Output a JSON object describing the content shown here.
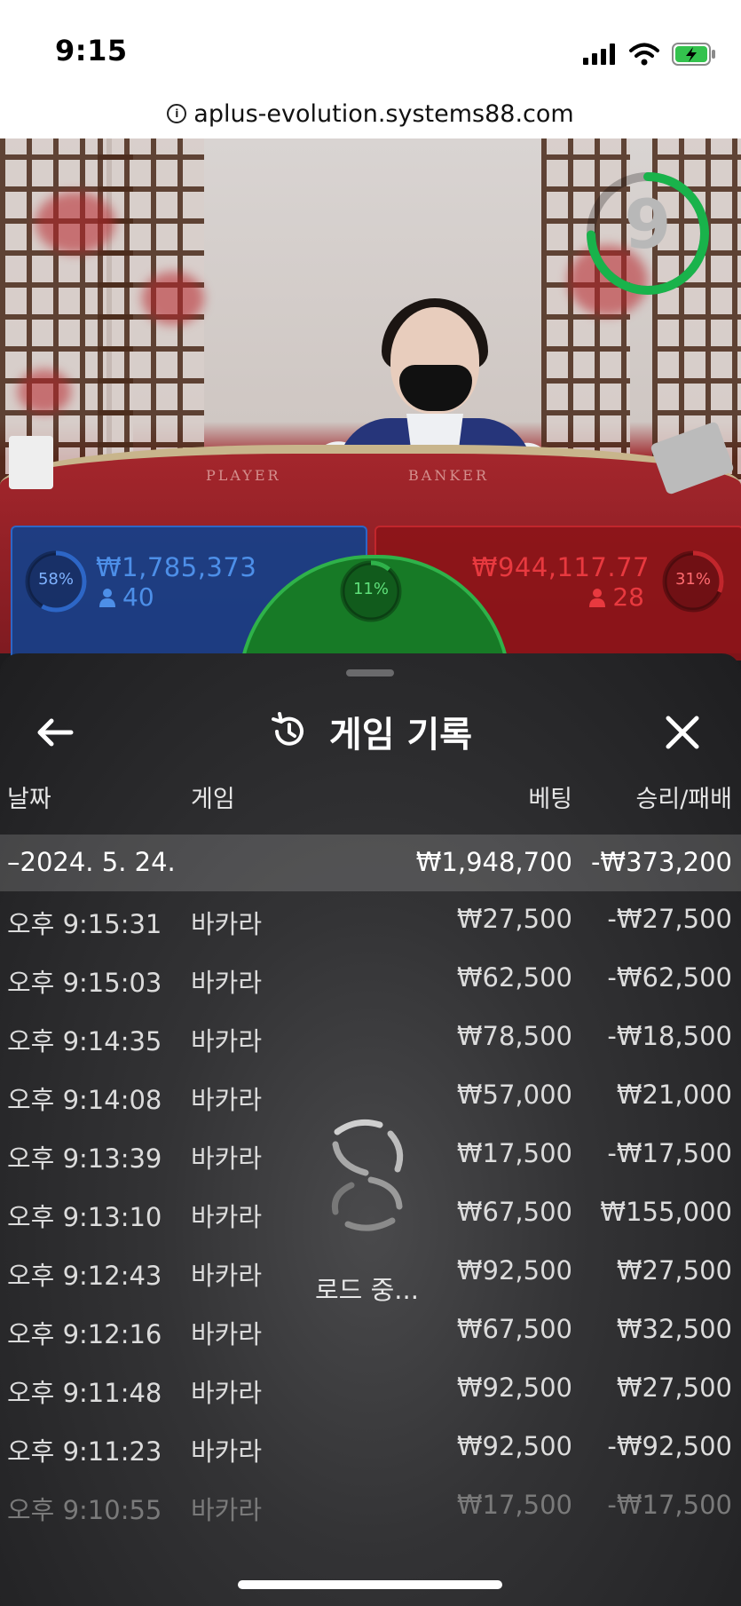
{
  "status": {
    "time": "9:15"
  },
  "browser": {
    "url": "aplus-evolution.systems88.com"
  },
  "video": {
    "timer": "9",
    "felt_player": "PLAYER",
    "felt_banker": "BANKER"
  },
  "bets": {
    "player": {
      "percent": "58%",
      "percent_value": 58,
      "amount": "₩1,785,373",
      "count": "40"
    },
    "banker": {
      "percent": "31%",
      "percent_value": 31,
      "amount": "₩944,117.77",
      "count": "28"
    },
    "tie": {
      "percent": "11%",
      "percent_value": 11
    }
  },
  "history": {
    "title": "게임 기록",
    "columns": {
      "date": "날짜",
      "game": "게임",
      "bet": "베팅",
      "result": "승리/패배"
    },
    "date_group": {
      "label": "–2024. 5. 24.",
      "bet_total": "₩1,948,700",
      "result_total": "-₩373,200"
    },
    "rows": [
      {
        "time": "오후 9:15:31",
        "game": "바카라",
        "bet": "₩27,500",
        "result": "-₩27,500"
      },
      {
        "time": "오후 9:15:03",
        "game": "바카라",
        "bet": "₩62,500",
        "result": "-₩62,500"
      },
      {
        "time": "오후 9:14:35",
        "game": "바카라",
        "bet": "₩78,500",
        "result": "-₩18,500"
      },
      {
        "time": "오후 9:14:08",
        "game": "바카라",
        "bet": "₩57,000",
        "result": "₩21,000"
      },
      {
        "time": "오후 9:13:39",
        "game": "바카라",
        "bet": "₩17,500",
        "result": "-₩17,500"
      },
      {
        "time": "오후 9:13:10",
        "game": "바카라",
        "bet": "₩67,500",
        "result": "₩155,000"
      },
      {
        "time": "오후 9:12:43",
        "game": "바카라",
        "bet": "₩92,500",
        "result": "₩27,500"
      },
      {
        "time": "오후 9:12:16",
        "game": "바카라",
        "bet": "₩67,500",
        "result": "₩32,500"
      },
      {
        "time": "오후 9:11:48",
        "game": "바카라",
        "bet": "₩92,500",
        "result": "₩27,500"
      },
      {
        "time": "오후 9:11:23",
        "game": "바카라",
        "bet": "₩92,500",
        "result": "-₩92,500"
      },
      {
        "time": "오후 9:10:55",
        "game": "바카라",
        "bet": "₩17,500",
        "result": "-₩17,500"
      }
    ],
    "loading_text": "로드 중..."
  },
  "colors": {
    "player": "#2d66c6",
    "banker": "#c2262c",
    "tie": "#2fb24a",
    "timer": "#19b34b"
  }
}
